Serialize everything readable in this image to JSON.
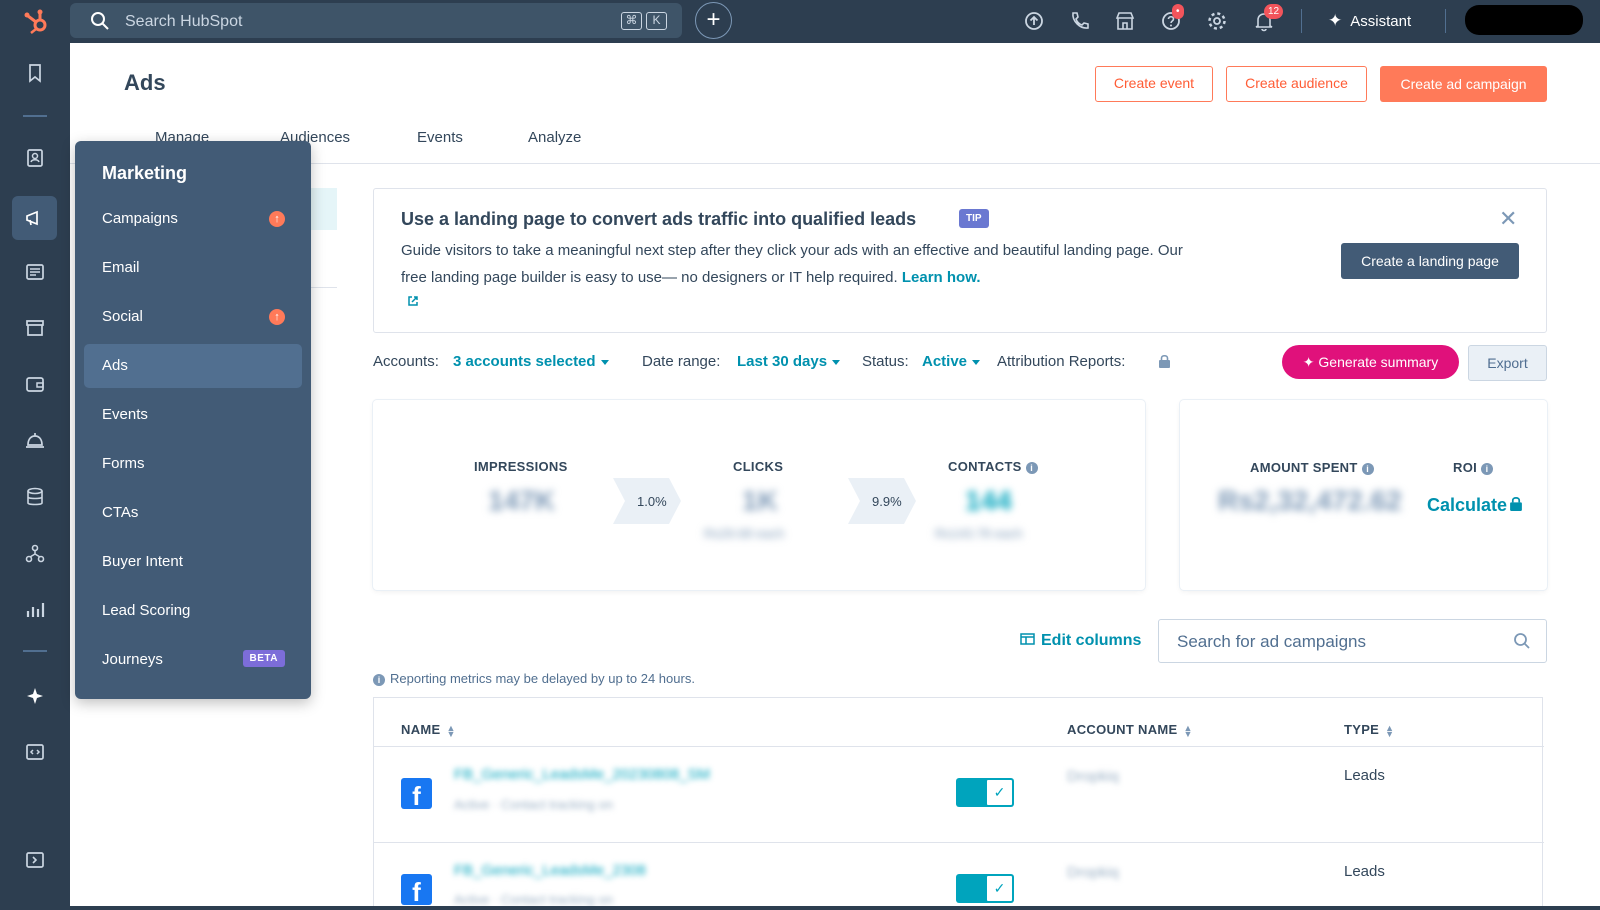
{
  "topbar": {
    "search_placeholder": "Search HubSpot",
    "shortcut_keys": [
      "⌘",
      "K"
    ],
    "help_badge": "•",
    "notifications_count": "12",
    "assistant_label": "Assistant"
  },
  "page": {
    "title": "Ads",
    "buttons": {
      "create_event": "Create event",
      "create_audience": "Create audience",
      "create_campaign": "Create ad campaign"
    },
    "tabs": [
      "Manage",
      "Audiences",
      "Events",
      "Analyze"
    ]
  },
  "flyout": {
    "title": "Marketing",
    "items": [
      {
        "label": "Campaigns",
        "indicator": "arrow"
      },
      {
        "label": "Email"
      },
      {
        "label": "Social",
        "indicator": "arrow"
      },
      {
        "label": "Ads",
        "active": true
      },
      {
        "label": "Events"
      },
      {
        "label": "Forms"
      },
      {
        "label": "CTAs"
      },
      {
        "label": "Buyer Intent"
      },
      {
        "label": "Lead Scoring"
      },
      {
        "label": "Journeys",
        "badge": "BETA"
      }
    ]
  },
  "tip": {
    "title": "Use a landing page to convert ads traffic into qualified leads",
    "badge": "TIP",
    "body": "Guide visitors to take a meaningful next step after they click your ads with an effective and beautiful landing page. Our free landing page builder is easy to use— no designers or IT help required.",
    "link": "Learn how.",
    "cta": "Create a landing page"
  },
  "filters": {
    "accounts_label": "Accounts:",
    "accounts_value": "3 accounts selected",
    "date_label": "Date range:",
    "date_value": "Last 30 days",
    "status_label": "Status:",
    "status_value": "Active",
    "attribution_label": "Attribution Reports:",
    "generate_label": "Generate summary",
    "export_label": "Export"
  },
  "metrics": {
    "impressions_label": "IMPRESSIONS",
    "impressions_value": "147K",
    "clicks_label": "CLICKS",
    "clicks_value": "1K",
    "clicks_sub": "Rs29.68 each",
    "contacts_label": "CONTACTS",
    "contacts_value": "144",
    "contacts_sub": "Rs143.78 each",
    "rate1": "1.0%",
    "rate2": "9.9%",
    "amount_label": "AMOUNT SPENT",
    "amount_value": "Rs2,32,472.62",
    "roi_label": "ROI",
    "roi_action": "Calculate"
  },
  "table": {
    "edit_columns": "Edit columns",
    "search_placeholder": "Search for ad campaigns",
    "note": "Reporting metrics may be delayed by up to 24 hours.",
    "headers": {
      "name": "NAME",
      "account": "ACCOUNT NAME",
      "type": "TYPE"
    },
    "rows": [
      {
        "name": "FB_Generic_LeadsMe_20230808_SM",
        "meta": "Active · Contact tracking on",
        "account": "Dropkiq",
        "type": "Leads"
      },
      {
        "name": "FB_Generic_LeadsMe_2308",
        "meta": "Active · Contact tracking on",
        "account": "Dropkiq",
        "type": "Leads"
      }
    ]
  }
}
